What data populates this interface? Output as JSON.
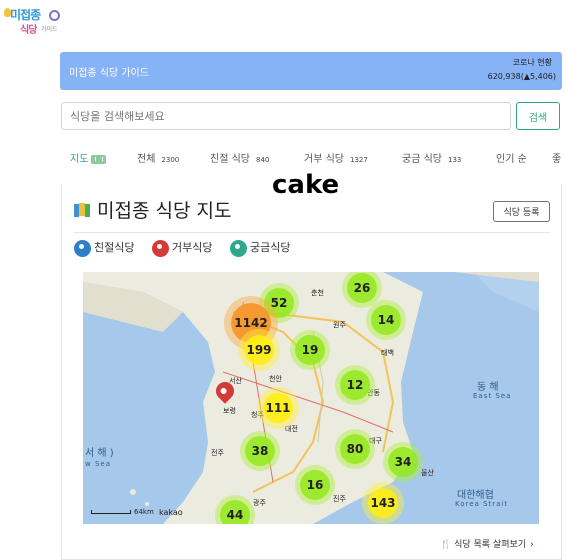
{
  "logo": {
    "line1": "미접종",
    "line2": "식당",
    "line3": "가이드"
  },
  "topbar": {
    "title": "미접종 식당 가이드",
    "covid_label": "코로나 현황",
    "covid_value": "620,938(▲5,406)"
  },
  "search": {
    "placeholder": "식당을 검색해보세요",
    "button": "검색"
  },
  "tabs": [
    {
      "label": "지도",
      "count": "",
      "active": true
    },
    {
      "label": "전체",
      "count": "2300"
    },
    {
      "label": "친절 식당",
      "count": "840"
    },
    {
      "label": "거부 식당",
      "count": "1327"
    },
    {
      "label": "궁금 식당",
      "count": "133"
    },
    {
      "label": "인기 순",
      "count": ""
    },
    {
      "label": "좋",
      "count": ""
    }
  ],
  "overlay_text": "cake",
  "map_section": {
    "title": "미접종 식당 지도",
    "register_button": "식당 등록",
    "legend": [
      {
        "label": "친절식당",
        "color": "#2f7fc6"
      },
      {
        "label": "거부식당",
        "color": "#d33a3a"
      },
      {
        "label": "궁금식당",
        "color": "#2fa88a"
      }
    ],
    "list_link": "식당 목록 살펴보기"
  },
  "map": {
    "clusters": [
      "52",
      "26",
      "1142",
      "14",
      "199",
      "19",
      "12",
      "111",
      "38",
      "80",
      "34",
      "16",
      "143",
      "44"
    ],
    "sea_labels": [
      "동 해",
      "East Sea",
      "대한해협",
      "Korea Strait",
      "서 해 )",
      "w Sea"
    ],
    "cities": [
      "춘천",
      "원주",
      "대전",
      "청주",
      "태백",
      "안동",
      "전주",
      "대구",
      "울산",
      "진주",
      "광주",
      "서산",
      "보령",
      "천안"
    ],
    "scale": "64km",
    "brand": "kakao"
  },
  "colors": {
    "accent": "#2fa87a",
    "topbar": "#86b3f5"
  }
}
